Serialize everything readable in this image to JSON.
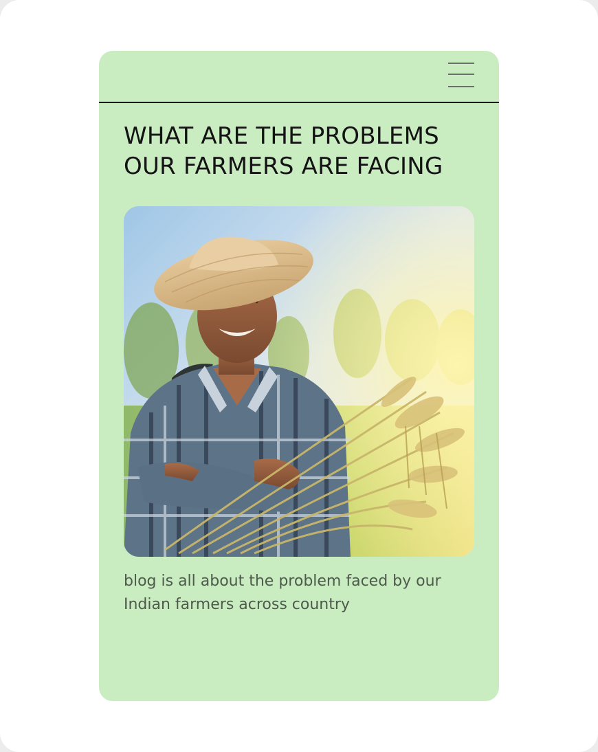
{
  "header": {
    "menu_icon": "hamburger-menu-icon"
  },
  "article": {
    "title": "WHAT ARE THE PROBLEMS OUR FARMERS ARE FACING",
    "image_description_icon": "farmer-photo",
    "description": "blog is all about the problem faced by our Indian farmers across country"
  },
  "colors": {
    "card_background": "#caecc1",
    "divider": "#1b1b1b",
    "title_text": "#141414",
    "body_text": "#4d5a4c"
  }
}
